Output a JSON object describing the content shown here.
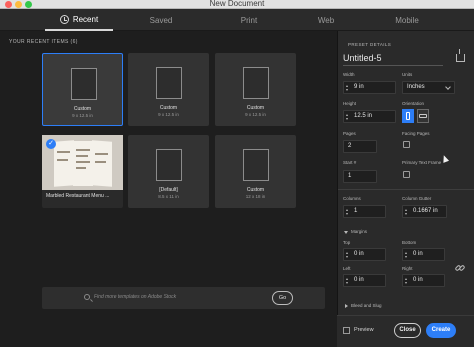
{
  "window": {
    "title": "New Document"
  },
  "tabs": [
    {
      "label": "Recent",
      "active": true
    },
    {
      "label": "Saved",
      "active": false
    },
    {
      "label": "Print",
      "active": false
    },
    {
      "label": "Web",
      "active": false
    },
    {
      "label": "Mobile",
      "active": false
    }
  ],
  "recent": {
    "heading": "YOUR RECENT ITEMS  (6)",
    "items": [
      {
        "name": "Custom",
        "size": "9 x 12.5 in",
        "selected": true
      },
      {
        "name": "Custom",
        "size": "9 x 12.5 in",
        "selected": false
      },
      {
        "name": "Custom",
        "size": "9 x 12.5 in",
        "selected": false
      },
      {
        "name": "Marbled Restaurant Menu ...",
        "size": "",
        "selected": false,
        "template": true
      },
      {
        "name": "[Default]",
        "size": "8.5 x 11 in",
        "selected": false
      },
      {
        "name": "Custom",
        "size": "12 x 18 in",
        "selected": false
      }
    ]
  },
  "search": {
    "placeholder": "Find more templates on Adobe Stock",
    "go_label": "Go"
  },
  "preset": {
    "heading": "PRESET DETAILS",
    "name": "Untitled-5",
    "width_label": "Width",
    "width_value": "9 in",
    "units_label": "Units",
    "units_value": "Inches",
    "height_label": "Height",
    "height_value": "12.5 in",
    "orientation_label": "Orientation",
    "pages_label": "Pages",
    "pages_value": "2",
    "facing_label": "Facing Pages",
    "start_label": "Start #",
    "start_value": "1",
    "primary_label": "Primary Text Frame",
    "columns_label": "Columns",
    "columns_value": "1",
    "gutter_label": "Column Gutter",
    "gutter_value": "0.1667 in",
    "margins_label": "Margins",
    "top_label": "Top",
    "top_value": "0 in",
    "bottom_label": "Bottom",
    "bottom_value": "0 in",
    "left_label": "Left",
    "left_value": "0 in",
    "right_label": "Right",
    "right_value": "0 in",
    "bleed_label": "Bleed and Slug"
  },
  "footer": {
    "preview_label": "Preview",
    "close_label": "Close",
    "create_label": "Create"
  },
  "colors": {
    "accent": "#2d7ef7",
    "panel": "#2a2a2a",
    "background": "#1e1e1e"
  }
}
